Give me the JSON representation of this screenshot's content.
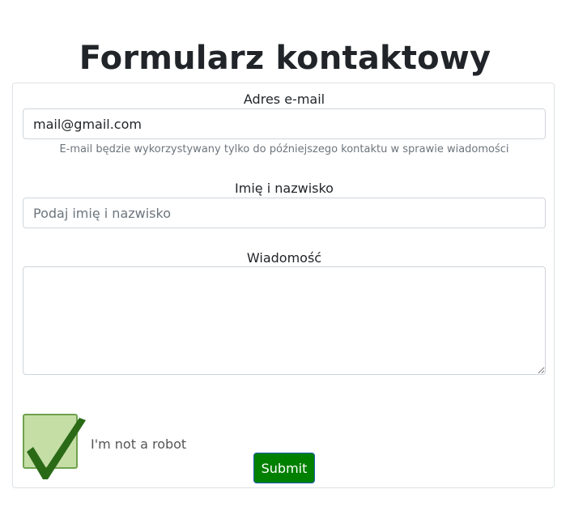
{
  "page": {
    "title": "Formularz kontaktowy"
  },
  "form": {
    "email": {
      "label": "Adres e-mail",
      "value": "mail@gmail.com",
      "help": "E-mail będzie wykorzystywany tylko do późniejszego kontaktu w sprawie wiadomości"
    },
    "name": {
      "label": "Imię i nazwisko",
      "placeholder": "Podaj imię i nazwisko"
    },
    "message": {
      "label": "Wiadomość"
    },
    "captcha": {
      "label": "I'm not a robot",
      "checked": true,
      "icon": "checkmark-icon"
    },
    "submit_label": "Submit"
  },
  "colors": {
    "submit_bg": "#008000",
    "captcha_bg": "#c5dea6",
    "check_color": "#2a6a17"
  }
}
